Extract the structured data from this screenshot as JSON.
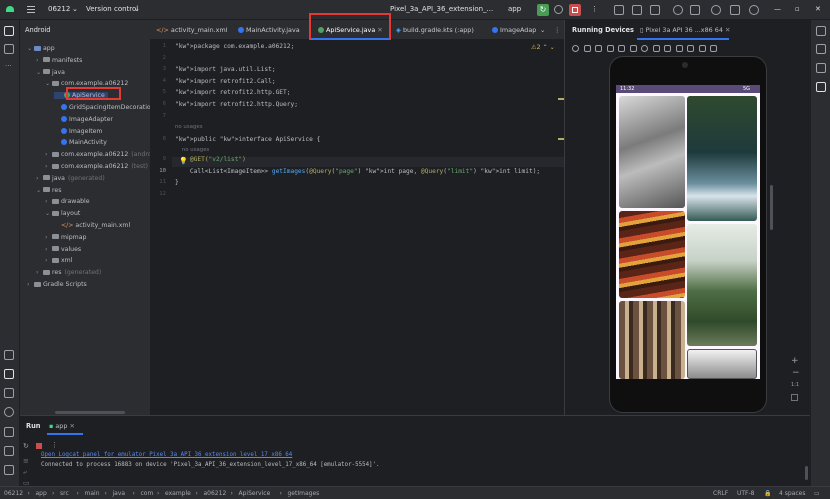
{
  "titlebar": {
    "project": "06212",
    "vcs": "Version control",
    "device": "Pixel_3a_API_36_extension_...",
    "run_config": "app"
  },
  "project_panel": {
    "title": "Android",
    "items": [
      {
        "label": "app",
        "depth": 0,
        "type": "module"
      },
      {
        "label": "manifests",
        "depth": 1,
        "type": "folder"
      },
      {
        "label": "java",
        "depth": 1,
        "type": "folder"
      },
      {
        "label": "com.example.a06212",
        "depth": 2,
        "type": "folder"
      },
      {
        "label": "ApiService",
        "depth": 3,
        "type": "interface"
      },
      {
        "label": "GridSpacingItemDecoratio",
        "depth": 3,
        "type": "class"
      },
      {
        "label": "ImageAdapter",
        "depth": 3,
        "type": "class"
      },
      {
        "label": "ImageItem",
        "depth": 3,
        "type": "class"
      },
      {
        "label": "MainActivity",
        "depth": 3,
        "type": "class"
      },
      {
        "label": "com.example.a06212",
        "suffix": "(andro",
        "depth": 2,
        "type": "folder"
      },
      {
        "label": "com.example.a06212",
        "suffix": "(test)",
        "depth": 2,
        "type": "folder"
      },
      {
        "label": "java",
        "suffix": "(generated)",
        "depth": 1,
        "type": "folder"
      },
      {
        "label": "res",
        "depth": 1,
        "type": "folder"
      },
      {
        "label": "drawable",
        "depth": 2,
        "type": "folder"
      },
      {
        "label": "layout",
        "depth": 2,
        "type": "folder"
      },
      {
        "label": "activity_main.xml",
        "depth": 3,
        "type": "xml"
      },
      {
        "label": "mipmap",
        "depth": 2,
        "type": "folder"
      },
      {
        "label": "values",
        "depth": 2,
        "type": "folder"
      },
      {
        "label": "xml",
        "depth": 2,
        "type": "folder"
      },
      {
        "label": "res",
        "suffix": "(generated)",
        "depth": 1,
        "type": "folder"
      },
      {
        "label": "Gradle Scripts",
        "depth": 0,
        "type": "gradle"
      }
    ]
  },
  "editor_tabs": [
    "activity_main.xml",
    "MainActivity.java",
    "ApiService.java",
    "build.gradle.kts (:app)",
    "ImageAdap"
  ],
  "active_tab": "ApiService.java",
  "warning_count": "2",
  "code_lines": [
    {
      "n": "1",
      "text": "package com.example.a06212;"
    },
    {
      "n": "2",
      "text": ""
    },
    {
      "n": "3",
      "text": "import java.util.List;"
    },
    {
      "n": "4",
      "text": "import retrofit2.Call;"
    },
    {
      "n": "5",
      "text": "import retrofit2.http.GET;"
    },
    {
      "n": "6",
      "text": "import retrofit2.http.Query;"
    },
    {
      "n": "7",
      "text": ""
    },
    {
      "n": "",
      "text": "no usages"
    },
    {
      "n": "8",
      "text": "public interface ApiService {"
    },
    {
      "n": "",
      "text": "    no usages"
    },
    {
      "n": "9",
      "text": "    @GET(\"v2/list\")"
    },
    {
      "n": "10",
      "text": "    Call<List<ImageItem>> getImages(@Query(\"page\") int page, @Query(\"limit\") int limit);"
    },
    {
      "n": "11",
      "text": "}"
    },
    {
      "n": "12",
      "text": ""
    }
  ],
  "running_devices": {
    "title": "Running Devices",
    "device_tab": "Pixel 3a API 36 ...x86 64",
    "status_time": "11:32",
    "status_right": "5G",
    "zoom": "1:1"
  },
  "bottom_panel": {
    "tab_run": "Run",
    "tab_app": "app",
    "log_link": "Open Logcat panel for emulator Pixel 3a API 36 extension level 17 x86 64",
    "log_text": "Connected to process 16883 on device 'Pixel_3a_API_36_extension_level_17_x86_64 [emulator-5554]'."
  },
  "breadcrumb": [
    "06212",
    "app",
    "src",
    "main",
    "java",
    "com",
    "example",
    "a06212",
    "ApiService",
    "getImages"
  ],
  "status": {
    "line_sep": "CRLF",
    "encoding": "UTF-8",
    "indent": "4 spaces"
  },
  "colors": {
    "accent": "#3574f0",
    "highlight": "#e53935",
    "run_green": "#499c54"
  }
}
